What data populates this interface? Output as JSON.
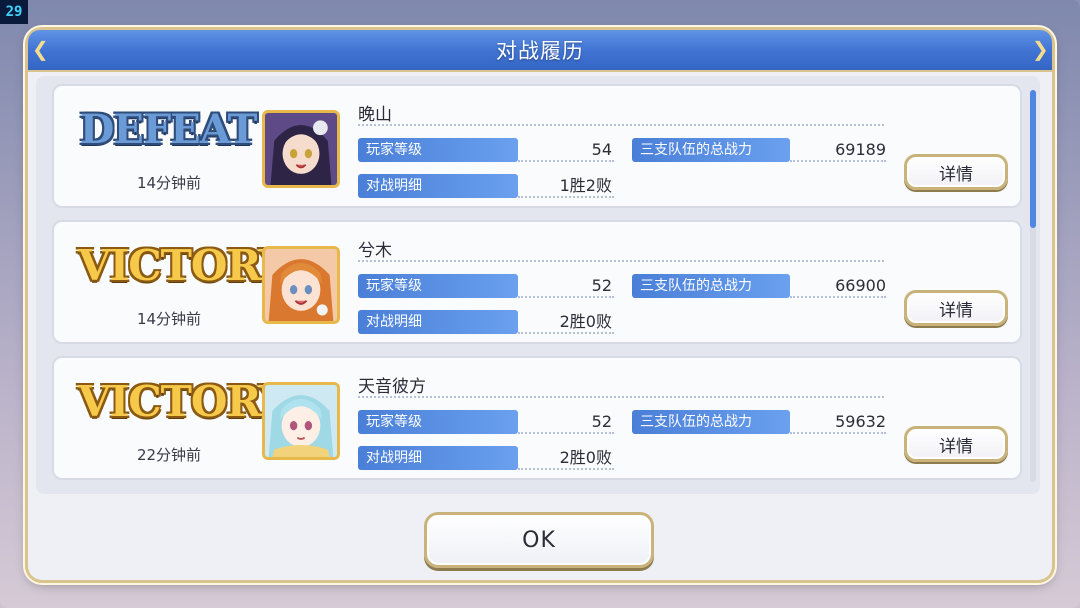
{
  "fps_counter": "29",
  "dialog": {
    "title": "对战履历",
    "ok_label": "OK"
  },
  "labels": {
    "player_level": "玩家等级",
    "battle_detail": "对战明细",
    "total_power": "三支队伍的总战力",
    "details_button": "详情"
  },
  "records": [
    {
      "result": "DEFEAT",
      "time": "14分钟前",
      "player_name": "晚山",
      "level": "54",
      "record": "1胜2败",
      "power": "69189"
    },
    {
      "result": "VICTORY",
      "time": "14分钟前",
      "player_name": "兮木",
      "level": "52",
      "record": "2胜0败",
      "power": "66900"
    },
    {
      "result": "VICTORY",
      "time": "22分钟前",
      "player_name": "天音彼方",
      "level": "52",
      "record": "2胜0败",
      "power": "59632"
    }
  ],
  "colors": {
    "title_bar": "#3f72d2",
    "label_bg": "#4a7fd8",
    "gold_border": "#c9b37a",
    "victory": "#f6c94a",
    "defeat": "#6b9bd6"
  }
}
